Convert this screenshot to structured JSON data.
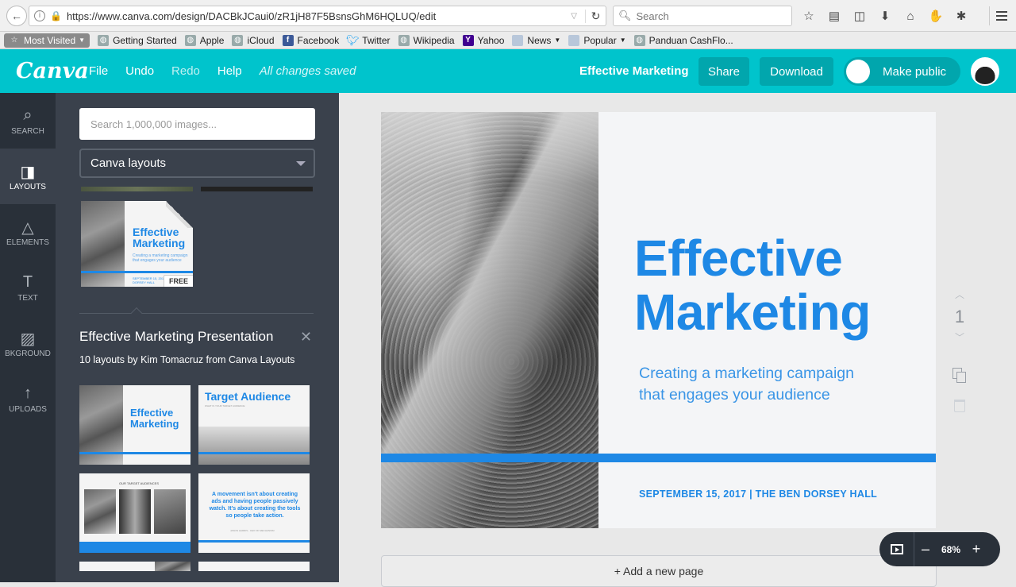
{
  "browser": {
    "url": "https://www.canva.com/design/DACBkJCaui0/zR1jH87F5BsnsGhM6HQLUQ/edit",
    "search_placeholder": "Search"
  },
  "bookmarks": [
    {
      "label": "Most Visited",
      "icon": "star-folder-icon"
    },
    {
      "label": "Getting Started",
      "icon": "globe-icon"
    },
    {
      "label": "Apple",
      "icon": "globe-icon"
    },
    {
      "label": "iCloud",
      "icon": "globe-icon"
    },
    {
      "label": "Facebook",
      "icon": "facebook-icon"
    },
    {
      "label": "Twitter",
      "icon": "twitter-icon"
    },
    {
      "label": "Wikipedia",
      "icon": "globe-icon"
    },
    {
      "label": "Yahoo",
      "icon": "yahoo-icon"
    },
    {
      "label": "News",
      "icon": "folder-icon"
    },
    {
      "label": "Popular",
      "icon": "folder-icon"
    },
    {
      "label": "Panduan CashFlo...",
      "icon": "globe-icon"
    }
  ],
  "header": {
    "logo": "Canva",
    "menu": {
      "file": "File",
      "undo": "Undo",
      "redo": "Redo",
      "help": "Help"
    },
    "saved_status": "All changes saved",
    "doc_title": "Effective Marketing",
    "share": "Share",
    "download": "Download",
    "make_public": "Make public",
    "accent_color": "#00c4cc"
  },
  "rail": {
    "search": "SEARCH",
    "layouts": "LAYOUTS",
    "elements": "ELEMENTS",
    "text": "TEXT",
    "background": "BKGROUND",
    "uploads": "UPLOADS"
  },
  "panel": {
    "search_placeholder": "Search 1,000,000 images...",
    "layout_select": "Canva layouts",
    "featured": {
      "title_line1": "Effective",
      "title_line2": "Marketing",
      "subtitle": "Creating a marketing campaign that engages your audience",
      "footer": "SEPTEMBER 15, 2017 | THE BEN DORSEY HALL",
      "badge": "FREE"
    },
    "set_title": "Effective Marketing Presentation",
    "set_subtitle": "10 layouts by Kim Tomacruz from Canva Layouts",
    "layouts": [
      {
        "title": "Effective Marketing"
      },
      {
        "title": "Target Audience",
        "sub": "WHAT IS YOUR TARGET AUDIENCE"
      },
      {
        "title": "OUR TARGET AUDIENCES"
      },
      {
        "title": "A movement isn't about creating ads and having people passively watch. It's about creating the tools so people take action.",
        "sub": "JASON HARRIS - CEO OF MECHANISM"
      }
    ]
  },
  "slide": {
    "title_line1": "Effective",
    "title_line2": "Marketing",
    "subtitle_line1": "Creating a marketing campaign",
    "subtitle_line2": "that engages your audience",
    "footer": "SEPTEMBER 15, 2017  |  THE BEN DORSEY HALL",
    "brand_blue": "#1e88e5"
  },
  "page_number": "1",
  "add_page": "+ Add a new page",
  "zoom": {
    "minus": "–",
    "value": "68%",
    "plus": "+"
  }
}
